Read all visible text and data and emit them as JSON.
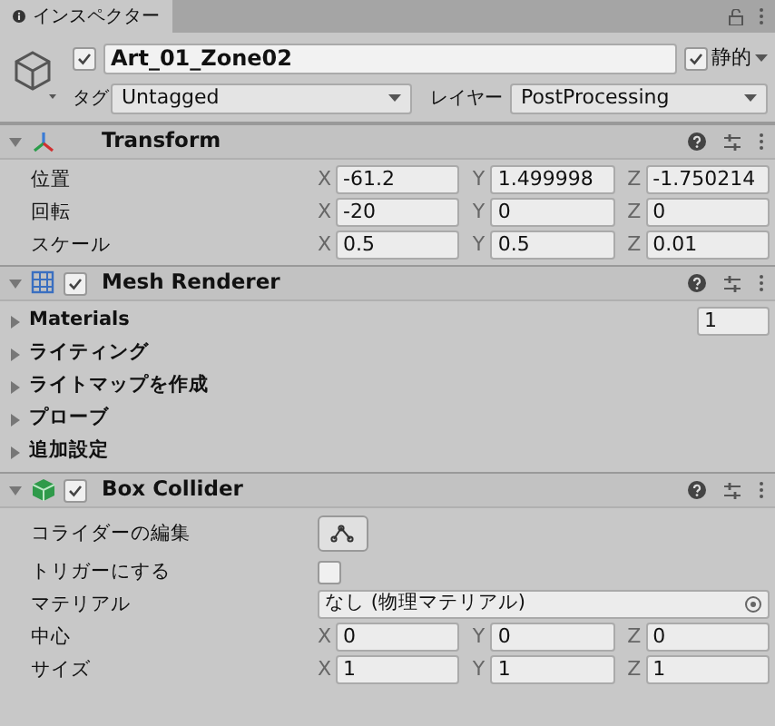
{
  "tab": {
    "label": "インスペクター",
    "selected": true
  },
  "object": {
    "active": true,
    "name": "Art_01_Zone02",
    "static": {
      "label": "静的",
      "checked": true
    },
    "tag": {
      "label": "タグ",
      "value": "Untagged"
    },
    "layer": {
      "label": "レイヤー",
      "value": "PostProcessing"
    }
  },
  "components": [
    {
      "kind": "transform",
      "title": "Transform",
      "expanded": true,
      "properties": [
        {
          "kind": "vector3",
          "label": "位置",
          "fields": [
            {
              "axis": "X",
              "value": "-61.2"
            },
            {
              "axis": "Y",
              "value": "1.499998"
            },
            {
              "axis": "Z",
              "value": "-1.750214"
            }
          ]
        },
        {
          "kind": "vector3",
          "label": "回転",
          "fields": [
            {
              "axis": "X",
              "value": "-20"
            },
            {
              "axis": "Y",
              "value": "0"
            },
            {
              "axis": "Z",
              "value": "0"
            }
          ]
        },
        {
          "kind": "vector3",
          "label": "スケール",
          "fields": [
            {
              "axis": "X",
              "value": "0.5"
            },
            {
              "axis": "Y",
              "value": "0.5"
            },
            {
              "axis": "Z",
              "value": "0.01"
            }
          ]
        }
      ]
    },
    {
      "kind": "mesh_renderer",
      "title": "Mesh Renderer",
      "enabled": true,
      "expanded": true,
      "properties": [
        {
          "kind": "count_foldout",
          "label": "Materials",
          "expanded": false,
          "value": "1"
        },
        {
          "kind": "foldout",
          "label": "ライティング",
          "expanded": false
        },
        {
          "kind": "foldout",
          "label": "ライトマップを作成",
          "expanded": false
        },
        {
          "kind": "foldout",
          "label": "プローブ",
          "expanded": false
        },
        {
          "kind": "foldout",
          "label": "追加設定",
          "expanded": false
        }
      ]
    },
    {
      "kind": "box_collider",
      "title": "Box Collider",
      "enabled": true,
      "expanded": true,
      "properties": [
        {
          "kind": "edit_button",
          "label": "コライダーの編集"
        },
        {
          "kind": "checkbox",
          "label": "トリガーにする",
          "checked": false
        },
        {
          "kind": "object_field",
          "label": "マテリアル",
          "value": "なし (物理マテリアル)"
        },
        {
          "kind": "vector3",
          "label": "中心",
          "fields": [
            {
              "axis": "X",
              "value": "0"
            },
            {
              "axis": "Y",
              "value": "0"
            },
            {
              "axis": "Z",
              "value": "0"
            }
          ]
        },
        {
          "kind": "vector3",
          "label": "サイズ",
          "fields": [
            {
              "axis": "X",
              "value": "1"
            },
            {
              "axis": "Y",
              "value": "1"
            },
            {
              "axis": "Z",
              "value": "1"
            }
          ]
        }
      ]
    }
  ]
}
